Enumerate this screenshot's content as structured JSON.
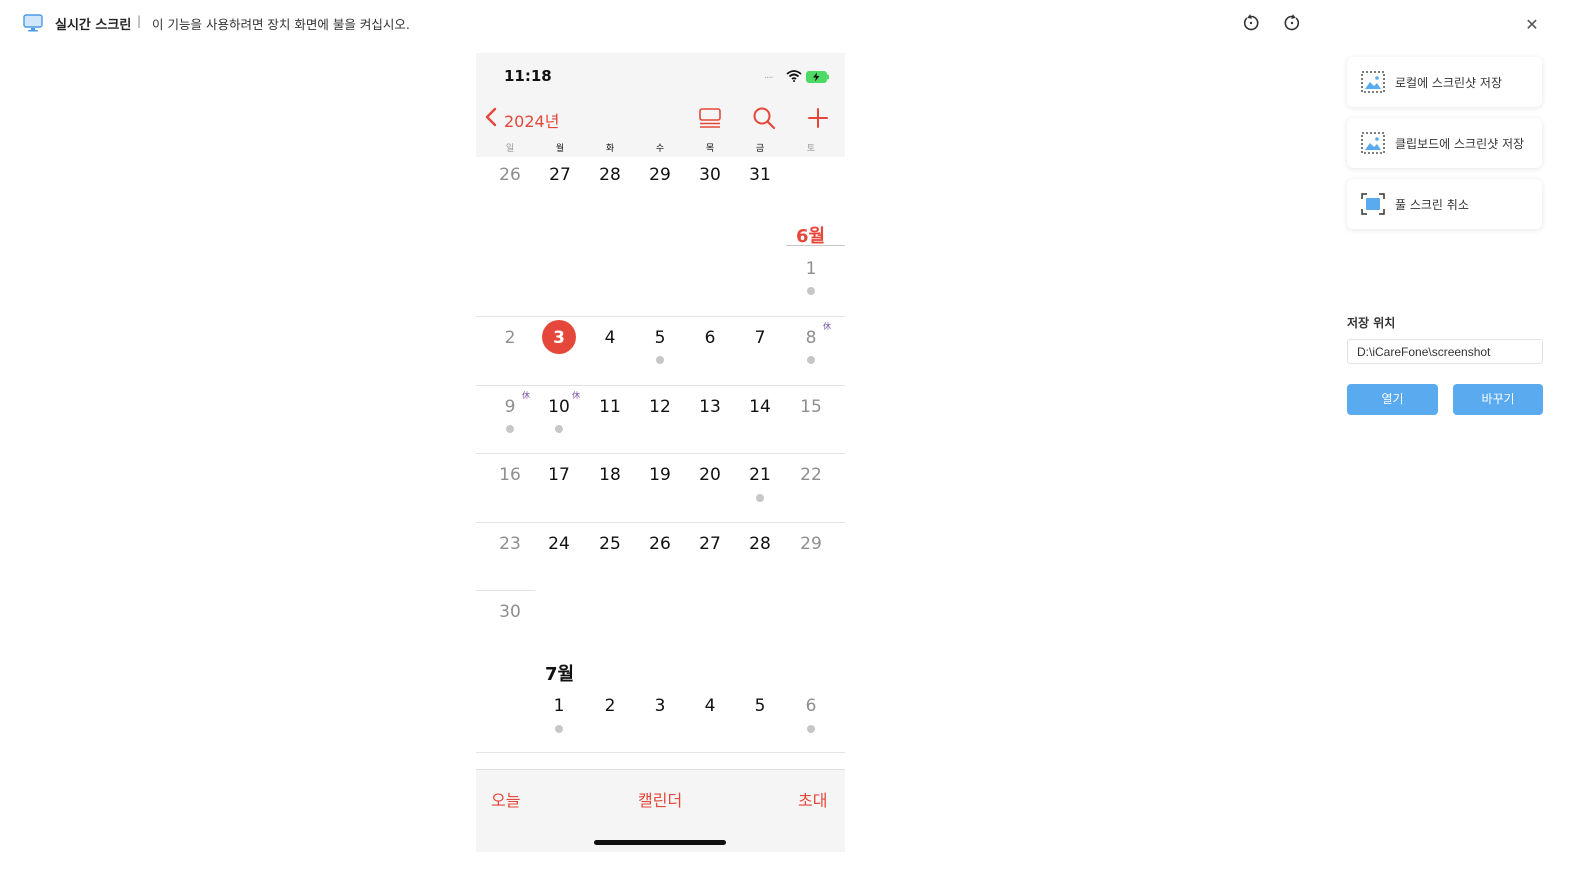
{
  "topbar": {
    "title": "실시간 스크린",
    "separator": "|",
    "hint": "이 기능을 사용하려면 장치 화면에 불을 켜십시오.",
    "rotate_left_icon": "rotate-ccw-icon",
    "rotate_right_icon": "rotate-cw-icon",
    "close": "✕"
  },
  "phone": {
    "status": {
      "time": "11:18",
      "signal": "....",
      "wifi_icon": "wifi-icon",
      "battery_icon": "battery-charging-icon"
    },
    "nav": {
      "year": "2024년"
    },
    "weekdays": [
      "일",
      "월",
      "화",
      "수",
      "목",
      "금",
      "토"
    ],
    "may_tail": [
      "26",
      "27",
      "28",
      "29",
      "30",
      "31"
    ],
    "june": {
      "label": "6월",
      "row1": [
        "1"
      ],
      "row2": [
        "2",
        "3",
        "4",
        "5",
        "6",
        "7",
        "8"
      ],
      "row3": [
        "9",
        "10",
        "11",
        "12",
        "13",
        "14",
        "15"
      ],
      "row4": [
        "16",
        "17",
        "18",
        "19",
        "20",
        "21",
        "22"
      ],
      "row5": [
        "23",
        "24",
        "25",
        "26",
        "27",
        "28",
        "29"
      ],
      "row6": [
        "30"
      ],
      "today": "3",
      "holiday_mark": "休"
    },
    "july": {
      "label": "7월",
      "row1": [
        "1",
        "2",
        "3",
        "4",
        "5",
        "6"
      ]
    },
    "tabs": {
      "today": "오늘",
      "calendars": "캘린더",
      "inbox": "초대"
    },
    "colors": {
      "accent": "#e5473b",
      "dot": "#c7c7c7",
      "holiday": "#7a4fa8"
    }
  },
  "panel": {
    "actions": [
      {
        "label": "로컬에 스크린샷 저장",
        "icon": "screenshot-local-icon"
      },
      {
        "label": "클립보드에 스크린샷 저장",
        "icon": "screenshot-clipboard-icon"
      },
      {
        "label": "풀 스크린 취소",
        "icon": "exit-fullscreen-icon"
      }
    ],
    "save_location_label": "저장 위치",
    "save_path": "D:\\iCareFone\\screenshot",
    "open_label": "열기",
    "change_label": "바꾸기",
    "button_color": "#5aaaf0"
  }
}
